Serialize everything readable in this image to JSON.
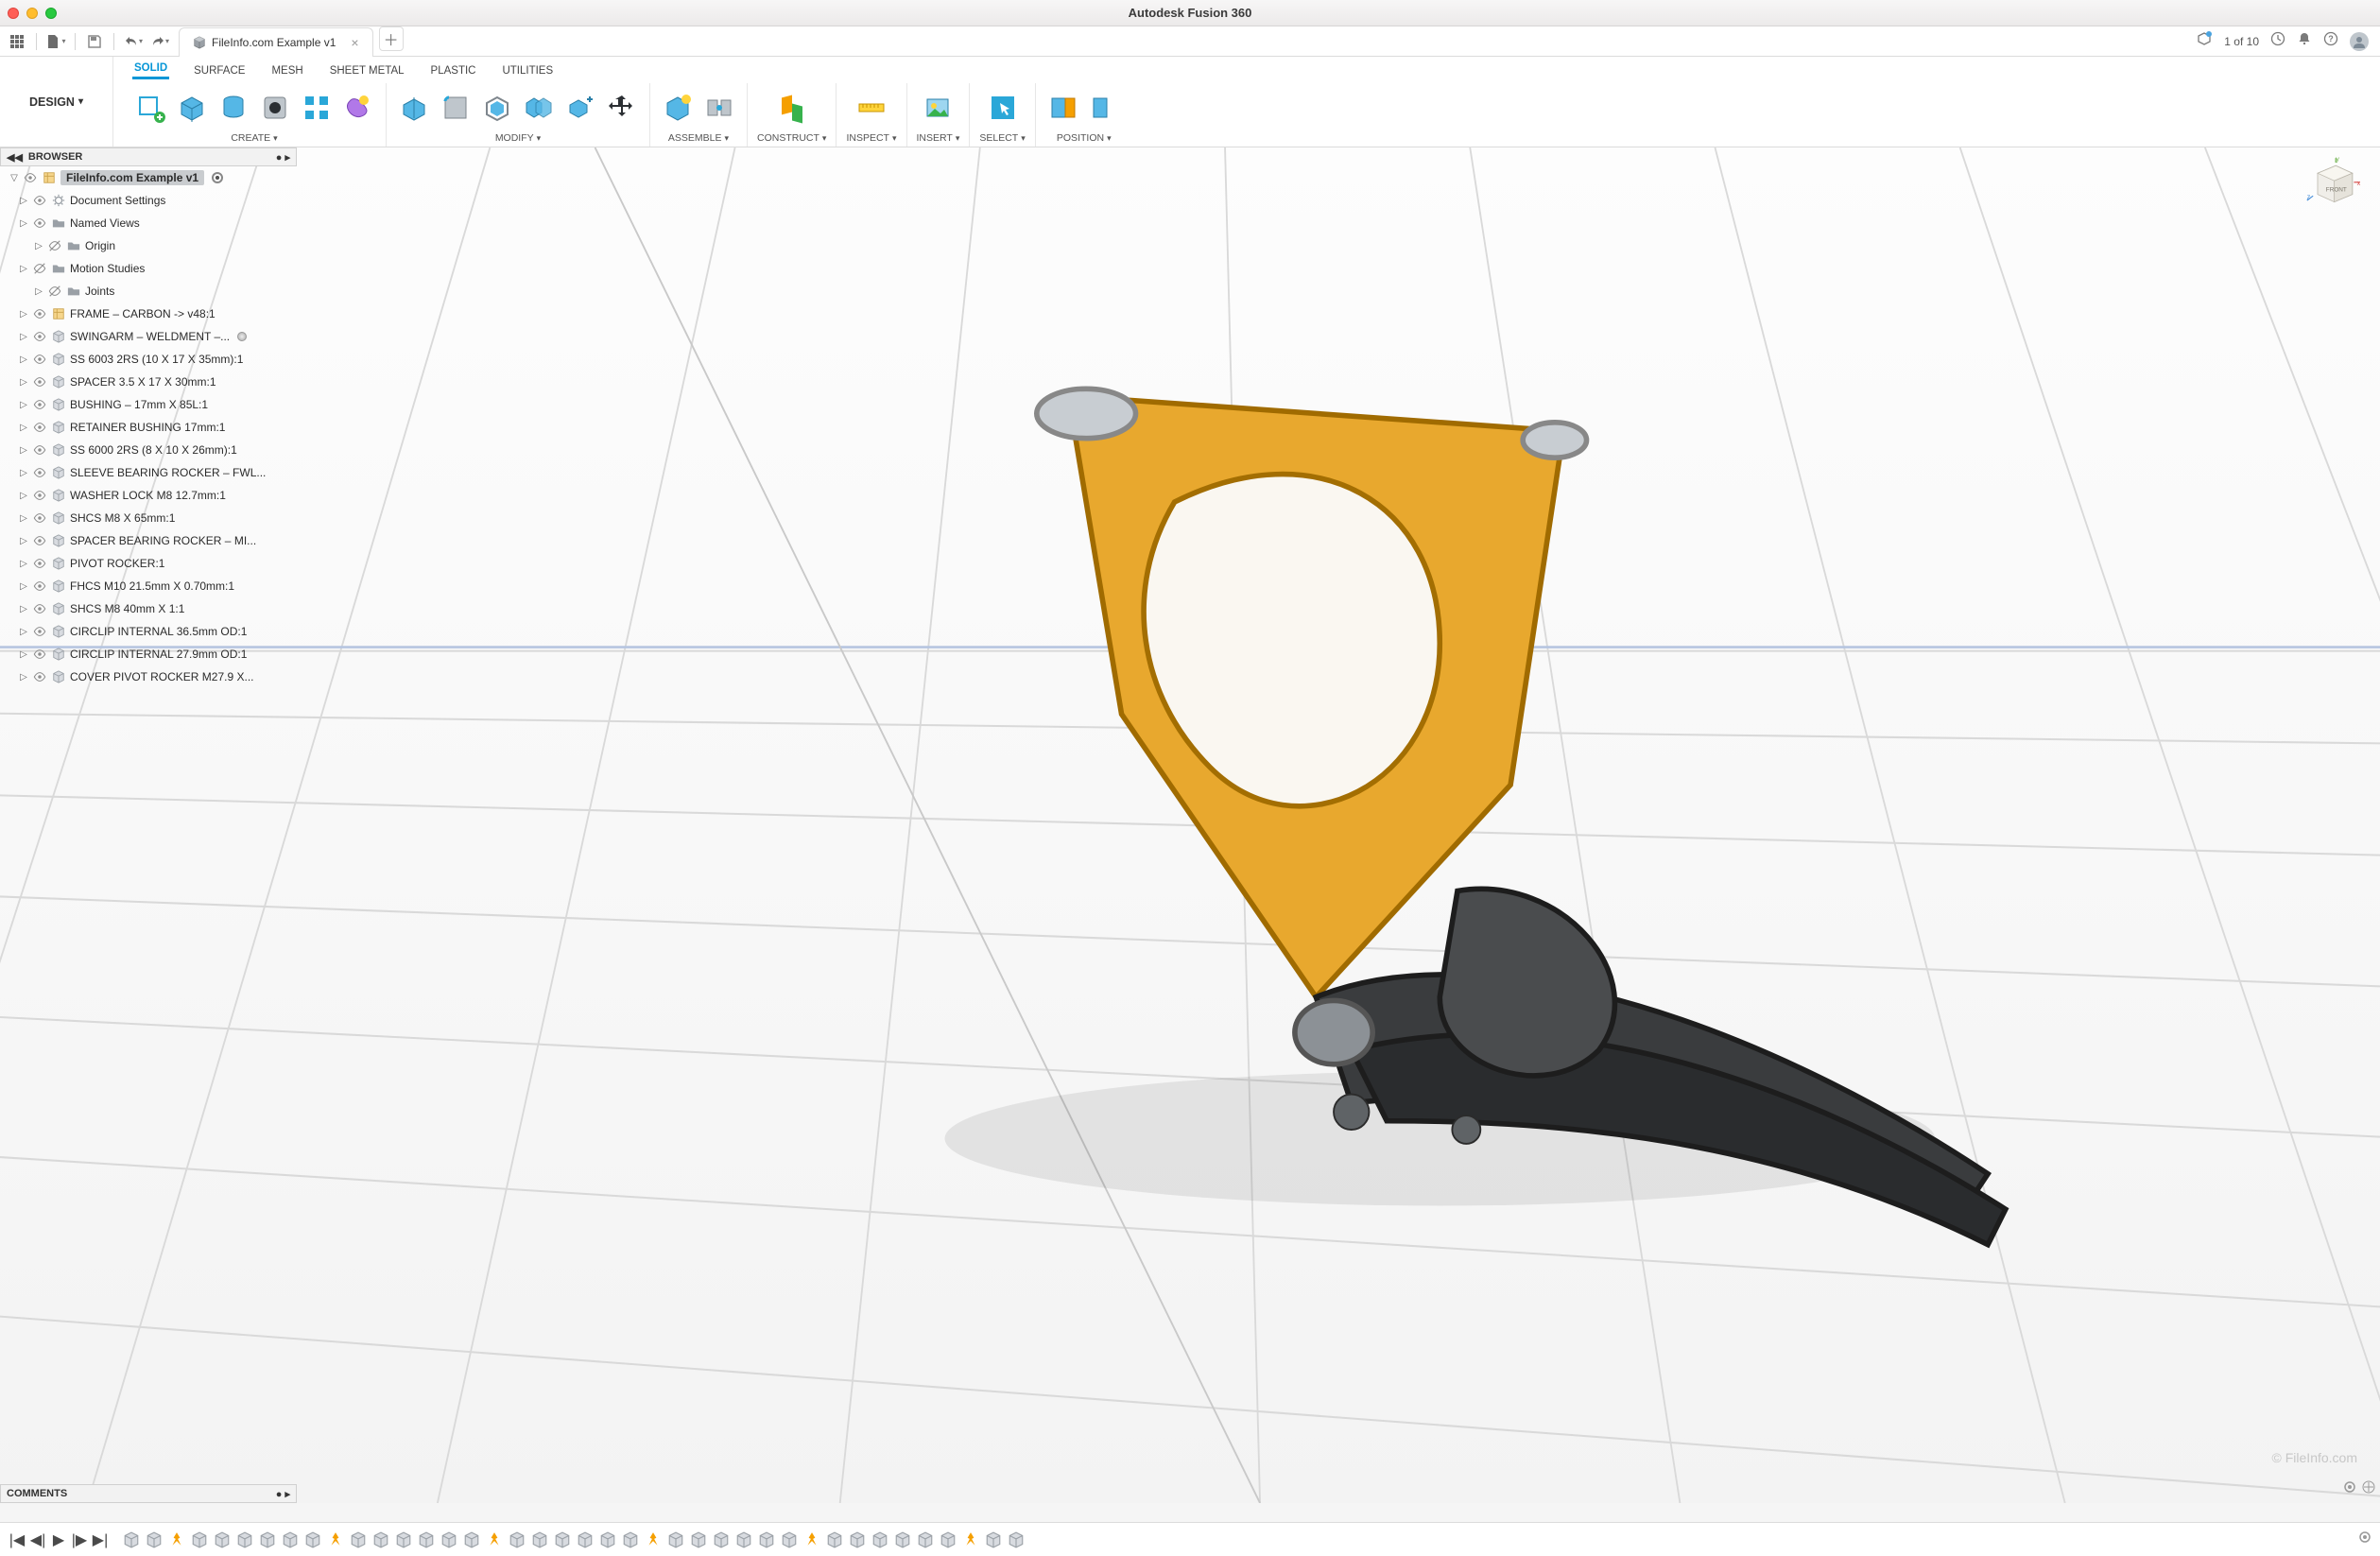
{
  "app": {
    "title": "Autodesk Fusion 360"
  },
  "qat": {
    "status_text": "1 of 10",
    "tab": {
      "label": "FileInfo.com Example v1"
    }
  },
  "ribbon": {
    "workspace_label": "DESIGN",
    "tabs": [
      "SOLID",
      "SURFACE",
      "MESH",
      "SHEET METAL",
      "PLASTIC",
      "UTILITIES"
    ],
    "active_tab": "SOLID",
    "groups": {
      "create": "CREATE",
      "modify": "MODIFY",
      "assemble": "ASSEMBLE",
      "construct": "CONSTRUCT",
      "inspect": "INSPECT",
      "insert": "INSERT",
      "select": "SELECT",
      "position": "POSITION"
    }
  },
  "browser": {
    "header": "BROWSER",
    "root": "FileInfo.com Example v1",
    "items": [
      {
        "icon": "gear",
        "label": "Document Settings"
      },
      {
        "icon": "folder",
        "label": "Named Views"
      },
      {
        "icon": "folder",
        "label": "Origin",
        "indent": 1,
        "hidden": true
      },
      {
        "icon": "folder",
        "label": "Motion Studies",
        "hidden": true
      },
      {
        "icon": "folder",
        "label": "Joints",
        "indent": 1,
        "hidden": true
      },
      {
        "icon": "comp",
        "label": "FRAME – CARBON -> v48:1"
      },
      {
        "icon": "cube",
        "label": "SWINGARM – WELDMENT –...",
        "dot": true
      },
      {
        "icon": "cube",
        "label": "SS 6003 2RS (10 X 17 X 35mm):1"
      },
      {
        "icon": "cube",
        "label": "SPACER 3.5 X 17 X 30mm:1"
      },
      {
        "icon": "cube",
        "label": "BUSHING – 17mm X 85L:1"
      },
      {
        "icon": "cube",
        "label": "RETAINER BUSHING 17mm:1"
      },
      {
        "icon": "cube",
        "label": "SS 6000 2RS (8 X 10 X 26mm):1"
      },
      {
        "icon": "cube",
        "label": "SLEEVE BEARING ROCKER – FWL..."
      },
      {
        "icon": "cube",
        "label": "WASHER LOCK M8 12.7mm:1"
      },
      {
        "icon": "cube",
        "label": "SHCS M8 X 65mm:1"
      },
      {
        "icon": "cube",
        "label": "SPACER BEARING ROCKER – MI..."
      },
      {
        "icon": "cube",
        "label": "PIVOT ROCKER:1"
      },
      {
        "icon": "cube",
        "label": "FHCS M10 21.5mm X 0.70mm:1"
      },
      {
        "icon": "cube",
        "label": "SHCS M8 40mm X 1:1"
      },
      {
        "icon": "cube",
        "label": "CIRCLIP INTERNAL 36.5mm OD:1"
      },
      {
        "icon": "cube",
        "label": "CIRCLIP INTERNAL 27.9mm OD:1"
      },
      {
        "icon": "cube",
        "label": "COVER PIVOT ROCKER M27.9 X..."
      }
    ]
  },
  "comments": {
    "header": "COMMENTS"
  },
  "watermark": "© FileInfo.com",
  "viewcube": {
    "face": "FRONT",
    "axes": {
      "x": "x",
      "y": "y",
      "z": "z"
    }
  },
  "timeline": {
    "item_count": 40
  }
}
